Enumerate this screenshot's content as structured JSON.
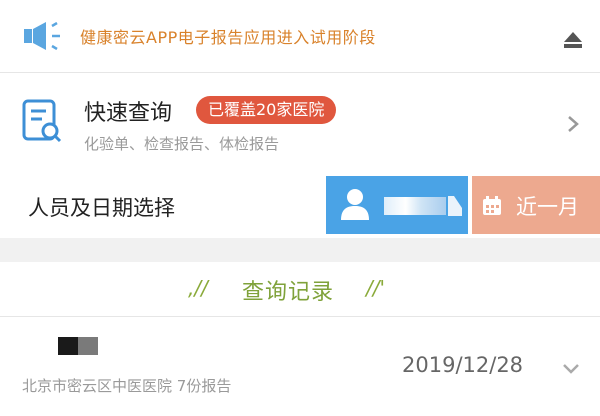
{
  "notice": {
    "text": "健康密云APP电子报告应用进入试用阶段"
  },
  "quick_query": {
    "title": "快速查询",
    "badge": "已覆盖20家医院",
    "subtitle": "化验单、检查报告、体检报告"
  },
  "selector": {
    "label": "人员及日期选择",
    "date_range": "近一月"
  },
  "records": {
    "section_title": "查询记录",
    "deco_left": ",//",
    "deco_right": "//'",
    "items": [
      {
        "hospital": "北京市密云区中医医院  7份报告",
        "date": "2019/12/28"
      }
    ]
  },
  "colors": {
    "notice_orange": "#d9822b",
    "badge_red": "#e0573e",
    "person_blue": "#4aa3e6",
    "date_salmon": "#eda98f",
    "section_green": "#7fa23a"
  }
}
